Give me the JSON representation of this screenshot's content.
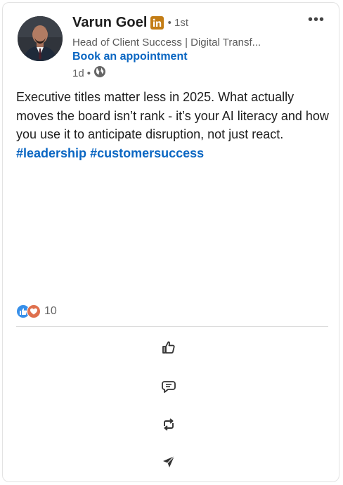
{
  "post": {
    "author": {
      "name": "Varun Goel",
      "degree": "• 1st",
      "headline": "Head of Client Success | Digital Transf...",
      "cta": "Book an appointment",
      "time": "1d",
      "time_separator": "•",
      "visibility_icon": "globe-icon",
      "badge_icon": "linkedin-icon"
    },
    "menu_label": "•••",
    "body": {
      "text": "Executive titles matter less in 2025. What actually moves the board isn’t rank - it’s your AI literacy and how you use it to anticipate disruption, not just react.",
      "hashtags": [
        "#leadership",
        "#customersuccess"
      ]
    },
    "reactions": {
      "icons": [
        "like-reaction-icon",
        "love-reaction-icon"
      ],
      "count": "10"
    },
    "actions": [
      {
        "name": "like",
        "icon": "thumbs-up-icon"
      },
      {
        "name": "comment",
        "icon": "comment-icon"
      },
      {
        "name": "repost",
        "icon": "repost-icon"
      },
      {
        "name": "send",
        "icon": "send-icon"
      }
    ],
    "colors": {
      "link": "#0a66c2",
      "badge": "#c37d16",
      "like": "#378fe9",
      "love": "#df704d"
    }
  }
}
